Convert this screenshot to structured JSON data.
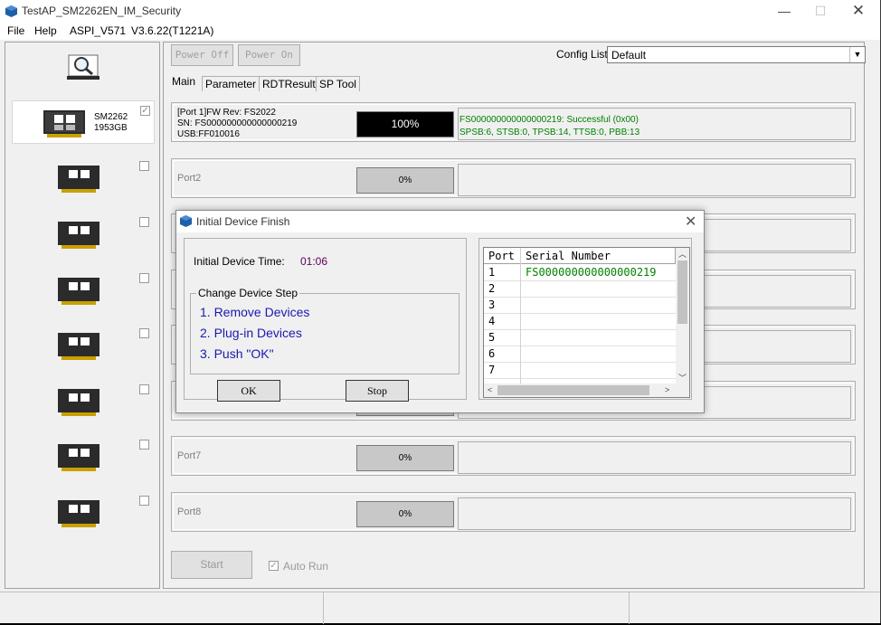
{
  "app": {
    "title": "TestAP_SM2262EN_IM_Security"
  },
  "menu": {
    "items": [
      "File",
      "Help",
      "ASPI_V571",
      "V3.6.22(T1221A)"
    ]
  },
  "window_controls": {
    "minimize": "—",
    "maximize": "☐",
    "close": "✕"
  },
  "toolbar": {
    "power_off": "Power Off",
    "power_on": "Power On",
    "config_label": "Config List",
    "config_value": "Default"
  },
  "tabs": [
    "Main",
    "Parameter",
    "RDTResult",
    "SP Tool"
  ],
  "devices": [
    {
      "name": "SM2262",
      "capacity": "1953GB",
      "checked": "✓"
    }
  ],
  "port1": {
    "line1": "[Port 1]FW Rev: FS2022",
    "line2": "SN: FS000000000000000219",
    "line3": "USB:FF010016",
    "progress": "100%",
    "status_line1": "FS000000000000000219: Successful (0x00)",
    "status_line2": "SPSB:6, STSB:0, TPSB:14, TTSB:0, PBB:13"
  },
  "ports": [
    {
      "label": "Port2",
      "progress": "0%"
    },
    {
      "label": "Port7",
      "progress": "0%"
    },
    {
      "label": "Port8",
      "progress": "0%"
    }
  ],
  "bottom": {
    "start": "Start",
    "auto_run": "Auto Run",
    "auto_run_check": "✓"
  },
  "dialog": {
    "title": "Initial Device Finish",
    "close": "✕",
    "time_label": "Initial Device Time:",
    "time_value": "01:06",
    "step_group": "Change Device Step",
    "steps": [
      "1. Remove Devices",
      "2. Plug-in Devices",
      "3. Push \"OK\""
    ],
    "ok": "OK",
    "stop": "Stop",
    "grid": {
      "headers": [
        "Port",
        "Serial Number"
      ],
      "rows": [
        {
          "port": "1",
          "serial": "FS000000000000000219"
        },
        {
          "port": "2",
          "serial": ""
        },
        {
          "port": "3",
          "serial": ""
        },
        {
          "port": "4",
          "serial": ""
        },
        {
          "port": "5",
          "serial": ""
        },
        {
          "port": "6",
          "serial": ""
        },
        {
          "port": "7",
          "serial": ""
        }
      ]
    },
    "scroll": {
      "up": "︿",
      "down": "﹀",
      "left": "<",
      "right": ">"
    }
  },
  "colors": {
    "success_green": "#008000",
    "step_blue": "#1a1ab0",
    "time_purple": "#5a005a"
  }
}
